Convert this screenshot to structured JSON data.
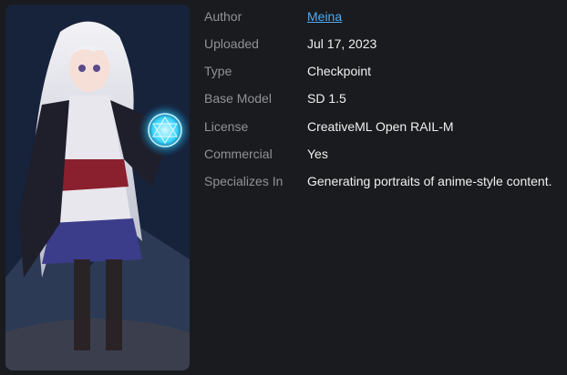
{
  "image": {
    "alt_icon": "anime-portrait-image"
  },
  "details": [
    {
      "key": "author",
      "label": "Author",
      "value": "Meina",
      "is_link": true
    },
    {
      "key": "uploaded",
      "label": "Uploaded",
      "value": "Jul 17, 2023"
    },
    {
      "key": "type",
      "label": "Type",
      "value": "Checkpoint"
    },
    {
      "key": "base_model",
      "label": "Base Model",
      "value": "SD 1.5"
    },
    {
      "key": "license",
      "label": "License",
      "value": "CreativeML Open RAIL-M"
    },
    {
      "key": "commercial",
      "label": "Commercial",
      "value": "Yes"
    },
    {
      "key": "specializes_in",
      "label": "Specializes In",
      "value": "Generating portraits of anime-style content."
    }
  ]
}
